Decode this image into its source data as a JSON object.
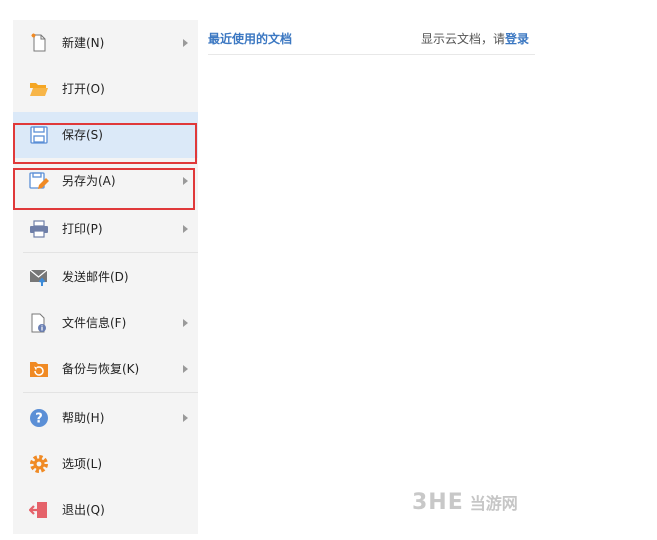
{
  "menu": {
    "items": [
      {
        "label": "新建(N)",
        "icon": "new-document-icon",
        "submenu": true
      },
      {
        "label": "打开(O)",
        "icon": "folder-open-icon",
        "submenu": false
      },
      {
        "label": "保存(S)",
        "icon": "save-icon",
        "submenu": false
      },
      {
        "label": "另存为(A)",
        "icon": "save-as-icon",
        "submenu": true
      },
      {
        "label": "打印(P)",
        "icon": "printer-icon",
        "submenu": true
      },
      {
        "label": "发送邮件(D)",
        "icon": "mail-icon",
        "submenu": false
      },
      {
        "label": "文件信息(F)",
        "icon": "file-info-icon",
        "submenu": true
      },
      {
        "label": "备份与恢复(K)",
        "icon": "backup-restore-icon",
        "submenu": true
      },
      {
        "label": "帮助(H)",
        "icon": "help-icon",
        "submenu": true
      },
      {
        "label": "选项(L)",
        "icon": "options-gear-icon",
        "submenu": false
      },
      {
        "label": "退出(Q)",
        "icon": "exit-icon",
        "submenu": false
      }
    ]
  },
  "recent": {
    "title": "最近使用的文档",
    "cloud_prefix": "显示云文档，请",
    "login_link": "登录"
  },
  "watermark": {
    "logo": "3HE",
    "text": "当游网"
  },
  "colors": {
    "accent": "#3c78c2",
    "highlight": "#dbe9f8",
    "annotation_red": "#e0393a",
    "menu_bg": "#f4f4f4"
  }
}
